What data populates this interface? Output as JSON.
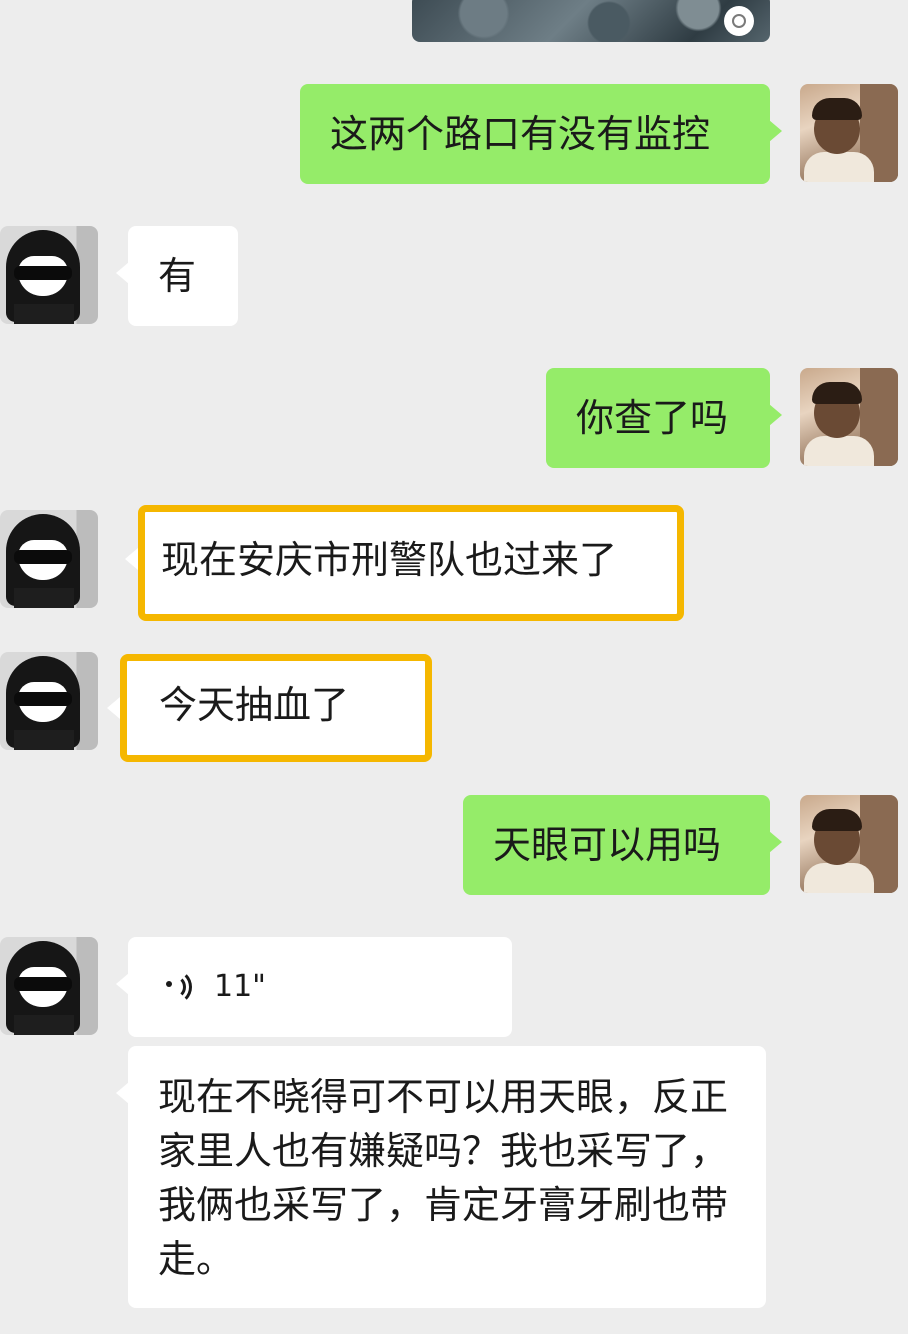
{
  "messages": {
    "m1": {
      "sender": "me",
      "text": "这两个路口有没有监控"
    },
    "m2": {
      "sender": "other",
      "text": "有"
    },
    "m3": {
      "sender": "me",
      "text": "你查了吗"
    },
    "m4": {
      "sender": "other",
      "text": "现在安庆市刑警队也过来了"
    },
    "m5": {
      "sender": "other",
      "text": "今天抽血了"
    },
    "m6": {
      "sender": "me",
      "text": "天眼可以用吗"
    },
    "m7": {
      "sender": "other",
      "type": "voice",
      "duration": "11\""
    },
    "m8": {
      "sender": "other",
      "text": "现在不晓得可不可以用天眼，反正家里人也有嫌疑吗？我也采写了，我俩也采写了，肯定牙膏牙刷也带走。"
    }
  },
  "highlight_color": "#f5b700",
  "outgoing_bubble_color": "#95ec69",
  "incoming_bubble_color": "#ffffff",
  "background_color": "#ededed"
}
